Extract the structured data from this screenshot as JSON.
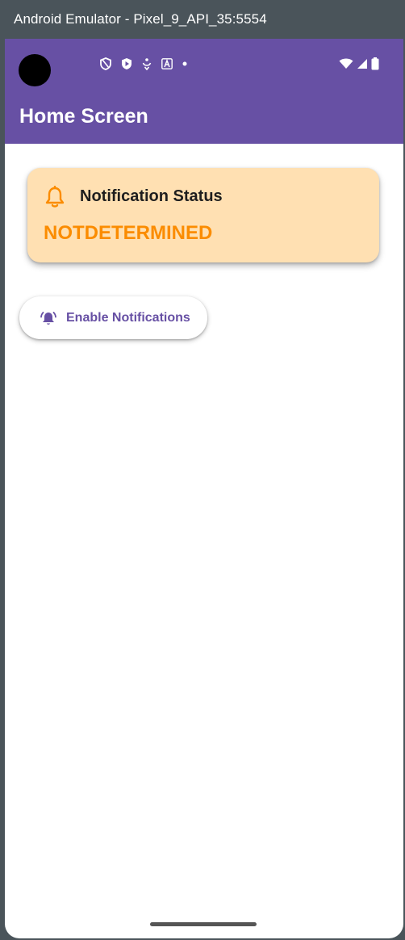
{
  "window": {
    "title": "Android Emulator - Pixel_9_API_35:5554"
  },
  "status_bar": {
    "left_icons": [
      "shield-outline-icon",
      "shield-play-icon",
      "accessibility-icon",
      "font-a-icon",
      "dot-icon"
    ],
    "right_icons": [
      "wifi-icon",
      "signal-icon",
      "battery-icon"
    ]
  },
  "app_bar": {
    "title": "Home Screen"
  },
  "status_card": {
    "title": "Notification Status",
    "value": "NOTDETERMINED",
    "icon": "bell-outline-icon"
  },
  "enable_button": {
    "label": "Enable Notifications",
    "icon": "notification-active-icon"
  },
  "colors": {
    "primary": "#6750a4",
    "card_bg": "#ffe0b2",
    "accent_orange": "#fb8c00"
  }
}
